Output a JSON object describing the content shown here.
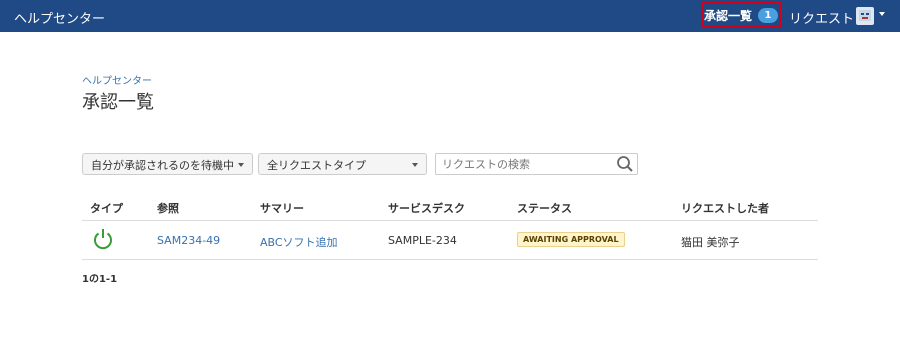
{
  "header": {
    "brand": "ヘルプセンター",
    "approvals_label": "承認一覧",
    "approvals_count": "1",
    "requests_label": "リクエスト",
    "avatar_icon": "user-avatar-icon"
  },
  "breadcrumb": "ヘルプセンター",
  "page_title": "承認一覧",
  "filters": {
    "approval_filter": "自分が承認されるのを待機中",
    "request_type_filter": "全リクエストタイプ",
    "search_placeholder": "リクエストの検索"
  },
  "table": {
    "headers": [
      "タイプ",
      "参照",
      "サマリー",
      "サービスデスク",
      "ステータス",
      "リクエストした者"
    ],
    "rows": [
      {
        "type_icon": "power-icon",
        "reference": "SAM234-49",
        "summary": "ABCソフト追加",
        "service_desk": "SAMPLE-234",
        "status": "AWAITING APPROVAL",
        "requester": "猫田 美弥子"
      }
    ]
  },
  "pagination": "1の1-1",
  "colors": {
    "header_bg": "#1f4a86",
    "highlight_border": "#d0021b",
    "link": "#3572b0",
    "icon_green": "#3a9b3a",
    "status_bg": "#fff4cc"
  }
}
